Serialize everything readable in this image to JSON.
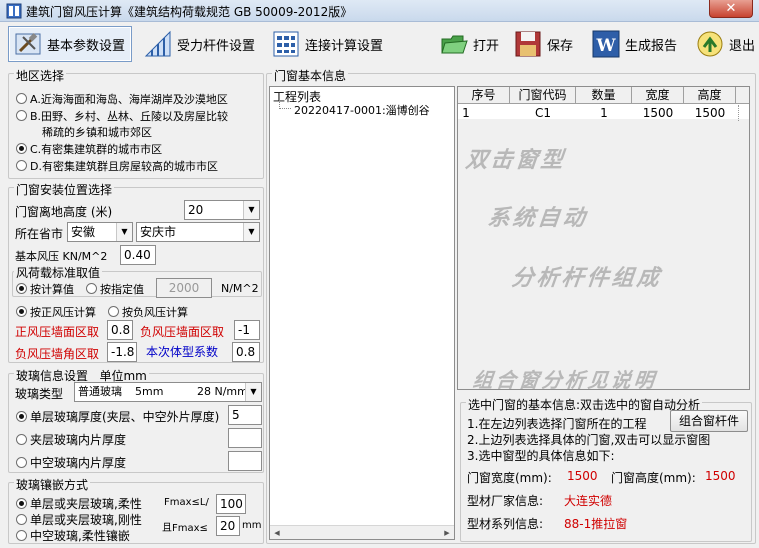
{
  "window": {
    "title": "建筑门窗风压计算《建筑结构荷载规范 GB 50009-2012版》",
    "close_glyph": "✕"
  },
  "toolbar": {
    "basic": "基本参数设置",
    "member": "受力杆件设置",
    "connection": "连接计算设置",
    "open": "打开",
    "save": "保存",
    "report": "生成报告",
    "exit": "退出"
  },
  "region": {
    "title": "地区选择",
    "options": [
      {
        "label": "A.近海海面和海岛、海岸湖岸及沙漠地区",
        "selected": false
      },
      {
        "label": "B.田野、乡村、丛林、丘陵以及房屋比较",
        "selected": false
      },
      {
        "label": "稀疏的乡镇和城市郊区",
        "selected": false
      },
      {
        "label": "C.有密集建筑群的城市市区",
        "selected": true
      },
      {
        "label": "D.有密集建筑群且房屋较高的城市市区",
        "selected": false
      }
    ]
  },
  "install": {
    "title": "门窗安装位置选择",
    "height_label": "门窗离地高度 (米)",
    "height_value": "20",
    "city_label": "所在省市",
    "province": "安徽",
    "city": "安庆市",
    "wind_label": "基本风压 KN/M^2",
    "wind_value": "0.40",
    "std_title": "风荷载标准取值",
    "calc_label": "按计算值",
    "spec_label": "按指定值",
    "spec_value": "2000",
    "spec_unit": "N/M^2",
    "pos_label": "按正风压计算",
    "neg_label": "按负风压计算",
    "pos_wall_label": "正风压墙面区取",
    "pos_wall_value": "0.8",
    "neg_wall_label": "负风压墙面区取",
    "neg_wall_value": "-1",
    "neg_corner_label": "负风压墙角区取",
    "neg_corner_value": "-1.8",
    "shape_label": "本次体型系数",
    "shape_value": "0.8"
  },
  "glass": {
    "title": "玻璃信息设置",
    "unit": "单位mm",
    "type_label": "玻璃类型",
    "type_value": "普通玻璃",
    "type_thick": "5mm",
    "type_strength": "28 N/mm^2",
    "single_label": "单层玻璃厚度(夹层、中空外片厚度)",
    "single_value": "5",
    "laminated_label": "夹层玻璃内片厚度",
    "hollow_label": "中空玻璃内片厚度"
  },
  "mount": {
    "title": "玻璃镶嵌方式",
    "opt1": "单层或夹层玻璃,柔性",
    "opt2": "单层或夹层玻璃,刚性",
    "opt3": "中空玻璃,柔性镶嵌",
    "fmax_label": "Fmax≤L/",
    "fmax_value": "100",
    "fmax2_label": "且Fmax≤",
    "fmax2_value": "20",
    "fmax2_unit": "mm"
  },
  "window_info": {
    "title": "门窗基本信息",
    "tree_title": "工程列表",
    "tree_item": "20220417-0001:淄博创谷",
    "columns": [
      "序号",
      "门窗代码",
      "数量",
      "宽度",
      "高度"
    ],
    "rows": [
      [
        "1",
        "C1",
        "1",
        "1500",
        "1500"
      ]
    ],
    "watermarks": [
      "双击窗型",
      "系统自动",
      "分析杆件组成",
      "组合窗分析见说明"
    ]
  },
  "selected": {
    "title": "选中门窗的基本信息:双击选中的窗自动分析",
    "steps": [
      "1.在左边列表选择门窗所在的工程",
      "2.上边列表选择具体的门窗,双击可以显示窗图",
      "3.选中窗型的具体信息如下:"
    ],
    "combo_button": "组合窗杆件",
    "width_label": "门窗宽度(mm):",
    "width_value": "1500",
    "height_label": "门窗高度(mm):",
    "height_value": "1500",
    "maker_label": "型材厂家信息:",
    "maker_value": "大连实德",
    "series_label": "型材系列信息:",
    "series_value": "88-1推拉窗"
  }
}
